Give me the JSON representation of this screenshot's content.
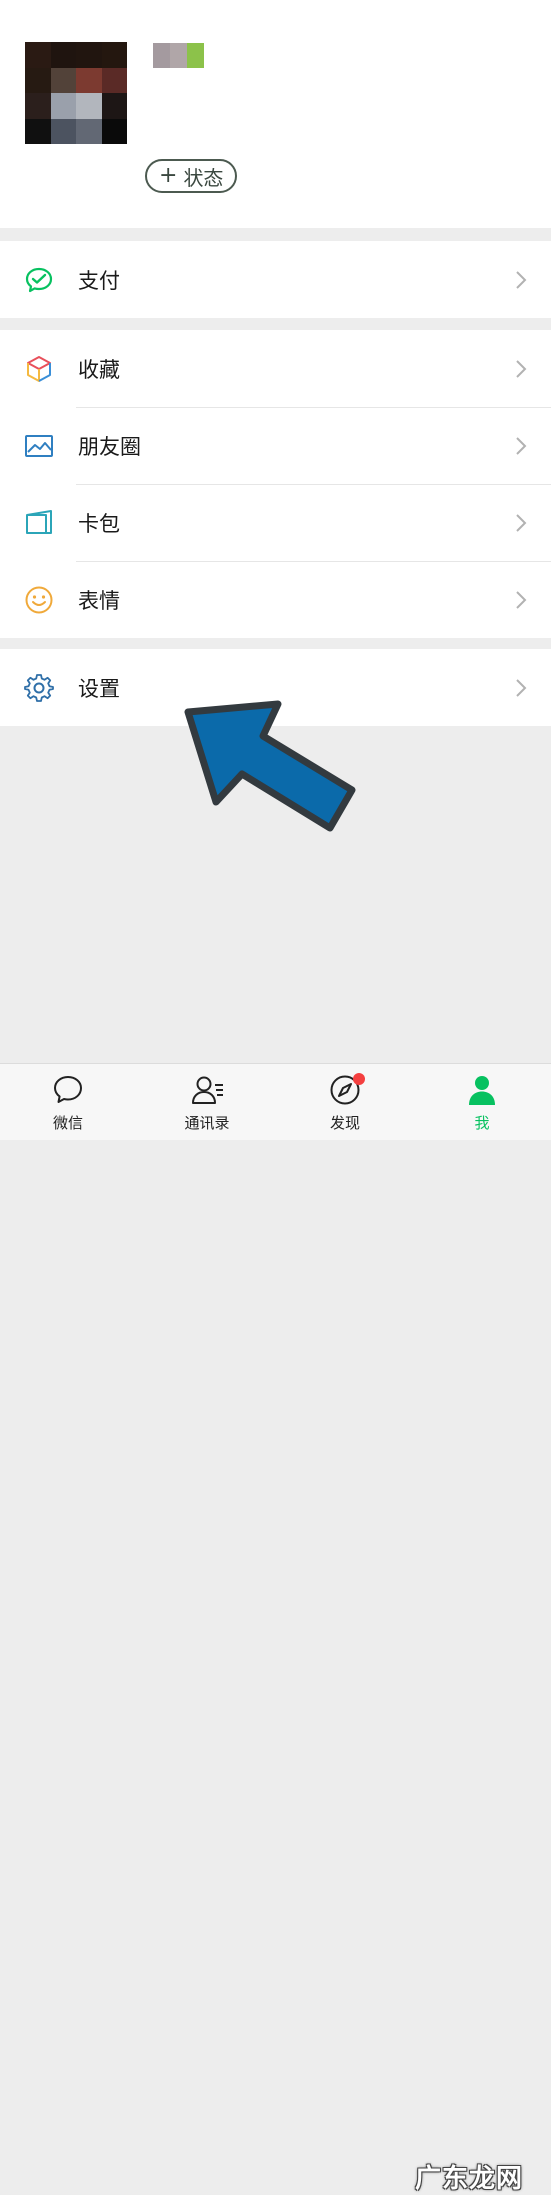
{
  "profile": {
    "status_label": "状态",
    "status_plus": "+"
  },
  "menu": {
    "pay": {
      "label": "支付",
      "icon": "wechat-pay-icon"
    },
    "favorites": {
      "label": "收藏",
      "icon": "cube-icon"
    },
    "moments": {
      "label": "朋友圈",
      "icon": "picture-icon"
    },
    "cards": {
      "label": "卡包",
      "icon": "card-icon"
    },
    "stickers": {
      "label": "表情",
      "icon": "smile-icon"
    },
    "settings": {
      "label": "设置",
      "icon": "gear-icon"
    }
  },
  "tabs": [
    {
      "label": "微信",
      "icon": "chat-bubble-icon"
    },
    {
      "label": "通讯录",
      "icon": "contacts-icon"
    },
    {
      "label": "发现",
      "icon": "compass-icon",
      "badge": true
    },
    {
      "label": "我",
      "icon": "person-icon",
      "active": true
    }
  ],
  "watermark": "广东龙网",
  "colors": {
    "accent": "#07c160",
    "arrow": "#0b6aaa",
    "badge": "#f43f3f",
    "background": "#ededed"
  }
}
